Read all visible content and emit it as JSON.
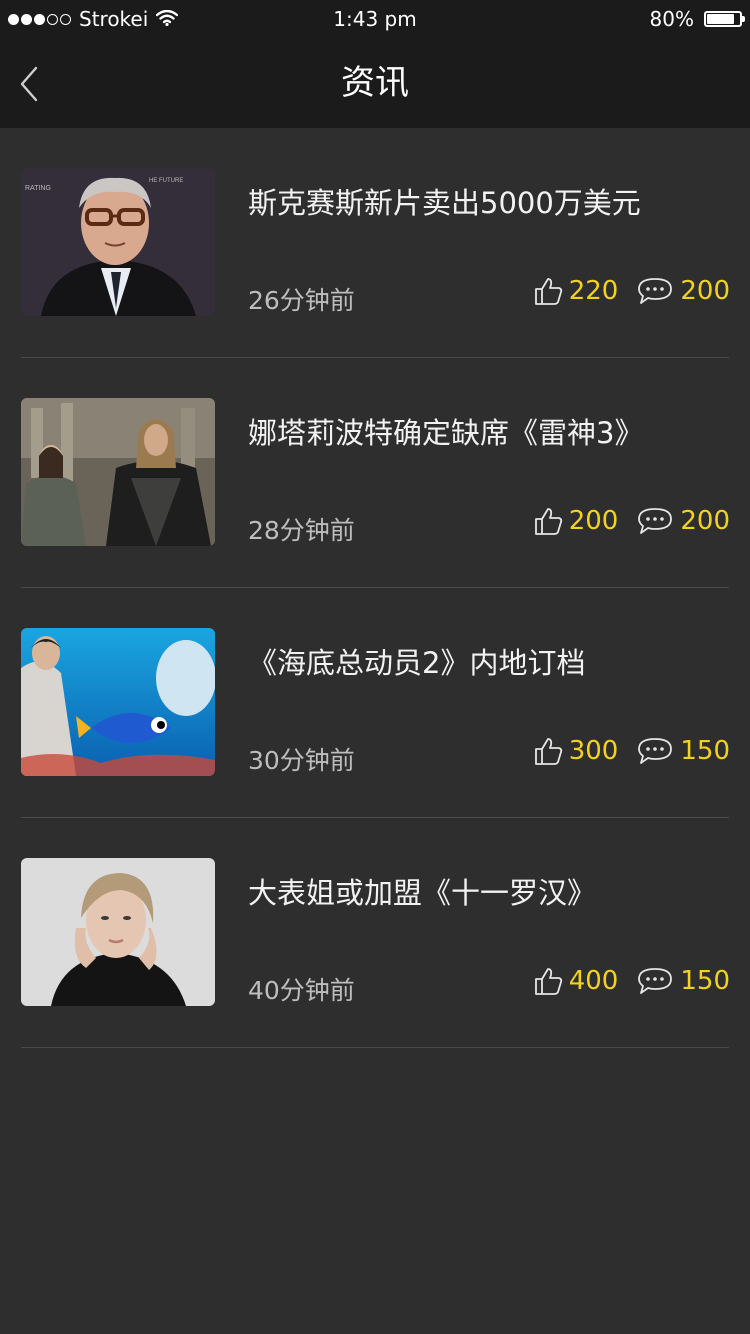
{
  "status_bar": {
    "carrier": "Strokei",
    "time": "1:43 pm",
    "battery": "80%",
    "battery_level": 0.8,
    "signal_dots_filled": 3,
    "signal_dots_total": 5
  },
  "navbar": {
    "title": "资讯",
    "back_icon": "chevron-left-icon"
  },
  "colors": {
    "background": "#2e2e2e",
    "bar": "#1b1b1b",
    "accent": "#f3d21c"
  },
  "news": [
    {
      "title": "斯克赛斯新片卖出5000万美元",
      "time": "26分钟前",
      "likes": "220",
      "comments": "200"
    },
    {
      "title": "娜塔莉波特确定缺席《雷神3》",
      "time": "28分钟前",
      "likes": "200",
      "comments": "200"
    },
    {
      "title": "《海底总动员2》内地订档",
      "time": "30分钟前",
      "likes": "300",
      "comments": "150"
    },
    {
      "title": "大表姐或加盟《十一罗汉》",
      "time": "40分钟前",
      "likes": "400",
      "comments": "150"
    }
  ]
}
